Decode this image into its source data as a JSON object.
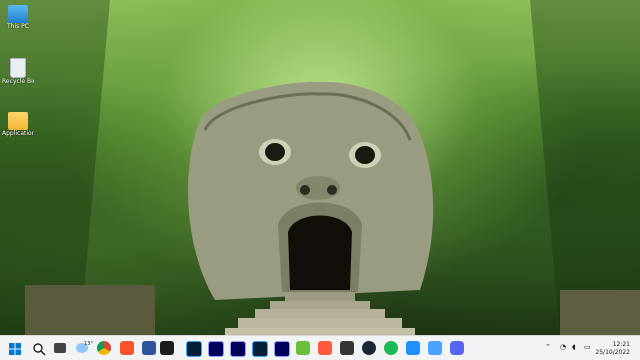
{
  "desktop": {
    "icons": [
      {
        "label": "This PC",
        "icon": "monitor-icon"
      },
      {
        "label": "Recycle Bin",
        "icon": "recycle-bin-icon"
      },
      {
        "label": "Applications",
        "icon": "folder-icon"
      }
    ]
  },
  "taskbar": {
    "weather_temp": "13°",
    "apps": [
      "windows-start",
      "search",
      "task-view",
      "weather",
      "brave",
      "chrome",
      "word",
      "notes",
      "photoshop",
      "premiere-pro",
      "after-effects",
      "lightroom",
      "audition",
      "camtasia",
      "clipchamp",
      "app",
      "steam",
      "spotify",
      "file-explorer",
      "app",
      "browser",
      "discord"
    ],
    "clock": {
      "time": "12:21",
      "date": "25/10/2022"
    }
  },
  "colors": {
    "taskbar": "#f1f3f4",
    "accent": "#0078d4"
  }
}
